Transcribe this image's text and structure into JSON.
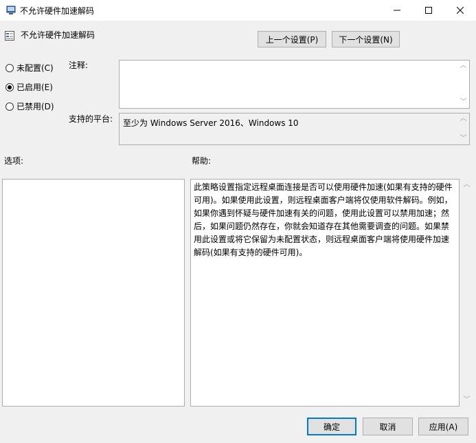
{
  "window": {
    "title": "不允许硬件加速解码"
  },
  "header": {
    "title": "不允许硬件加速解码"
  },
  "nav": {
    "prev_label": "上一个设置(P)",
    "next_label": "下一个设置(N)"
  },
  "radios": [
    {
      "label": "未配置(C)",
      "checked": false
    },
    {
      "label": "已启用(E)",
      "checked": true
    },
    {
      "label": "已禁用(D)",
      "checked": false
    }
  ],
  "labels": {
    "comment": "注释:",
    "platform": "支持的平台:",
    "options": "选项:",
    "help": "帮助:"
  },
  "platform_value": "至少为 Windows Server 2016、Windows 10",
  "help_text": "此策略设置指定远程桌面连接是否可以使用硬件加速(如果有支持的硬件可用)。如果使用此设置，则远程桌面客户端将仅使用软件解码。例如，如果你遇到怀疑与硬件加速有关的问题，使用此设置可以禁用加速；然后，如果问题仍然存在，你就会知道存在其他需要调查的问题。如果禁用此设置或将它保留为未配置状态，则远程桌面客户端将使用硬件加速解码(如果有支持的硬件可用)。",
  "footer": {
    "ok_label": "确定",
    "cancel_label": "取消",
    "apply_label": "应用(A)"
  },
  "icons": {
    "window": "policy-app-icon",
    "header": "policy-setting-icon"
  },
  "colors": {
    "accent": "#0078d7"
  }
}
